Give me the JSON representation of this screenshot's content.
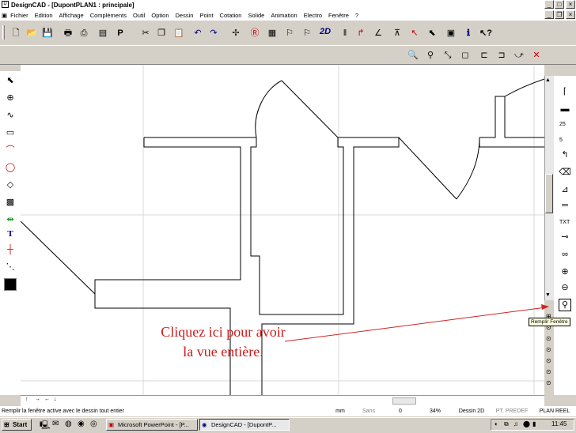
{
  "window": {
    "title": "DesignCAD - [DupontPLAN1 : principale]"
  },
  "menu": [
    "Fichier",
    "Edition",
    "Affichage",
    "Compléments",
    "Outil",
    "Option",
    "Dessin",
    "Point",
    "Cotation",
    "Solide",
    "Animation",
    "Electro",
    "Fenêtre",
    "?"
  ],
  "toolbar": {
    "mode_label": "2D"
  },
  "annotation": {
    "line1": "Cliquez ici pour avoir",
    "line2": "la vue entière."
  },
  "tooltip": "Remplir Fenêtre",
  "right_tools": {
    "size1": "25",
    "size2": "5",
    "txt": "TXT"
  },
  "status": {
    "message": "Remplir la fenêtre active avec le dessin tout entier",
    "fields": [
      "mm",
      "Sans",
      "0",
      "34%",
      "Dessin 2D",
      "PT. PREDEF",
      "PLAN REEL"
    ]
  },
  "taskbar": {
    "start": "Start",
    "tasks": [
      "Microsoft PowerPoint - [P...",
      "DesignCAD - [DupontP..."
    ],
    "clock": "11:45"
  },
  "colors": {
    "annotation": "#cc1b1b"
  }
}
